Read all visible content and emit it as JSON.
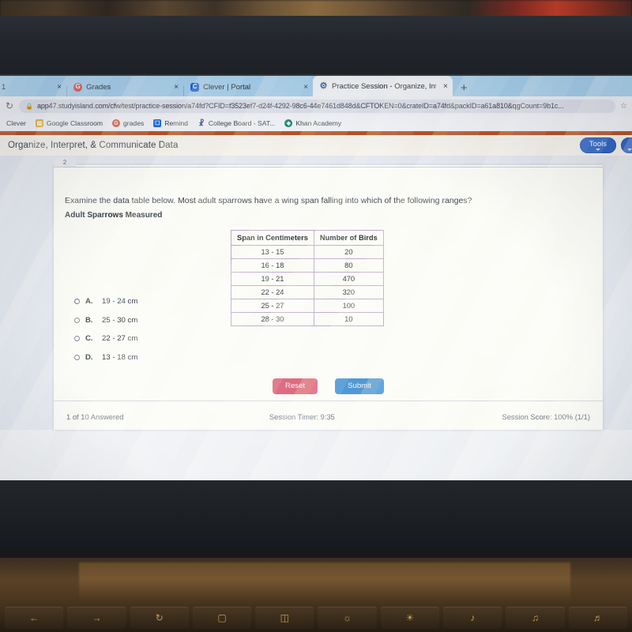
{
  "browser": {
    "tabs": [
      {
        "title": "1",
        "favicon": "",
        "active": false,
        "truncated": true
      },
      {
        "title": "Grades",
        "favicon": "grades-favicon",
        "active": false
      },
      {
        "title": "Clever | Portal",
        "favicon": "clever-favicon",
        "active": false
      },
      {
        "title": "Practice Session - Organize, Inte",
        "favicon": "study-island-favicon",
        "active": true
      }
    ],
    "new_tab_label": "+",
    "close_label": "×",
    "reload_icon": "↻",
    "lock_icon": "🔒",
    "star_icon": "☆",
    "url": "app47.studyisland.com/cfw/test/practice-session/a74fd?CFID=f3523ef7-d24f-4292-98c6-44e7461d848d&CFTOKEN=0&crateID=a74fd&packID=a61a810&qgCount=9b1c...",
    "bookmarks": [
      {
        "label": "Clever",
        "icon": ""
      },
      {
        "label": "Google Classroom",
        "icon": "google-classroom-icon"
      },
      {
        "label": "grades",
        "icon": "grades-icon"
      },
      {
        "label": "Remind",
        "icon": "remind-icon"
      },
      {
        "label": "College Board - SAT...",
        "icon": "college-board-icon"
      },
      {
        "label": "Khan Academy",
        "icon": "khan-academy-icon"
      }
    ]
  },
  "app": {
    "header_title": "Organize, Interpret, & Communicate Data",
    "tools_button": "Tools",
    "accent_orange": "#b8521f",
    "accent_blue": "#2f64c4"
  },
  "question": {
    "number": "2",
    "prompt": "Examine the data table below. Most adult sparrows have a wing span falling into which of the following ranges?",
    "table_title": "Adult Sparrows Measured",
    "options": [
      {
        "letter": "A.",
        "text": "19 - 24 cm",
        "selected": false
      },
      {
        "letter": "B.",
        "text": "25 - 30 cm",
        "selected": false
      },
      {
        "letter": "C.",
        "text": "22 - 27 cm",
        "selected": false
      },
      {
        "letter": "D.",
        "text": "13 - 18 cm",
        "selected": false
      }
    ]
  },
  "chart_data": {
    "type": "table",
    "title": "Adult Sparrows Measured",
    "columns": [
      "Span in Centimeters",
      "Number of Birds"
    ],
    "rows": [
      [
        "13 - 15",
        "20"
      ],
      [
        "16 - 18",
        "80"
      ],
      [
        "19 - 21",
        "470"
      ],
      [
        "22 - 24",
        "320"
      ],
      [
        "25 - 27",
        "100"
      ],
      [
        "28 - 30",
        "10"
      ]
    ],
    "categories": [
      "13 - 15",
      "16 - 18",
      "19 - 21",
      "22 - 24",
      "25 - 27",
      "28 - 30"
    ],
    "values": [
      20,
      80,
      470,
      320,
      100,
      10
    ],
    "xlabel": "Span in Centimeters",
    "ylabel": "Number of Birds"
  },
  "actions": {
    "reset_label": "Reset",
    "submit_label": "Submit",
    "reset_color": "#d8596b",
    "submit_color": "#3f8fd0"
  },
  "status": {
    "answered": "1 of 10 Answered",
    "timer": "Session Timer: 9:35",
    "score": "Session Score: 100% (1/1)"
  },
  "keyboard": {
    "keys": [
      "back-key",
      "forward-key",
      "reload-key",
      "fullscreen-key",
      "overview-key",
      "brightness-down-key",
      "brightness-up-key",
      "mute-key",
      "volume-down-key",
      "volume-up-key"
    ]
  }
}
